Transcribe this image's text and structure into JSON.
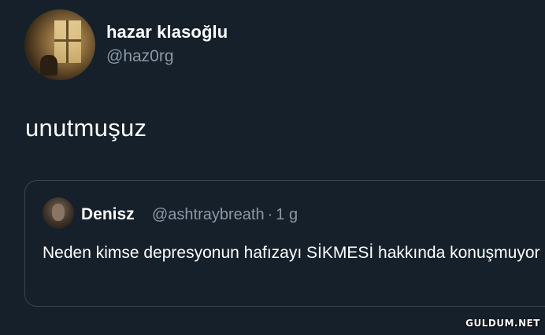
{
  "author": {
    "display_name": "hazar klasoğlu",
    "handle": "@haz0rg"
  },
  "tweet": {
    "text": "unutmuşuz"
  },
  "quoted_tweet": {
    "display_name": "Denisz",
    "handle": "@ashtraybreath",
    "separator": "·",
    "time": "1 g",
    "text": "Neden kimse depresyonun hafızayı SİKMESİ hakkında konuşmuyor"
  },
  "watermark": "GULDUM.NET"
}
